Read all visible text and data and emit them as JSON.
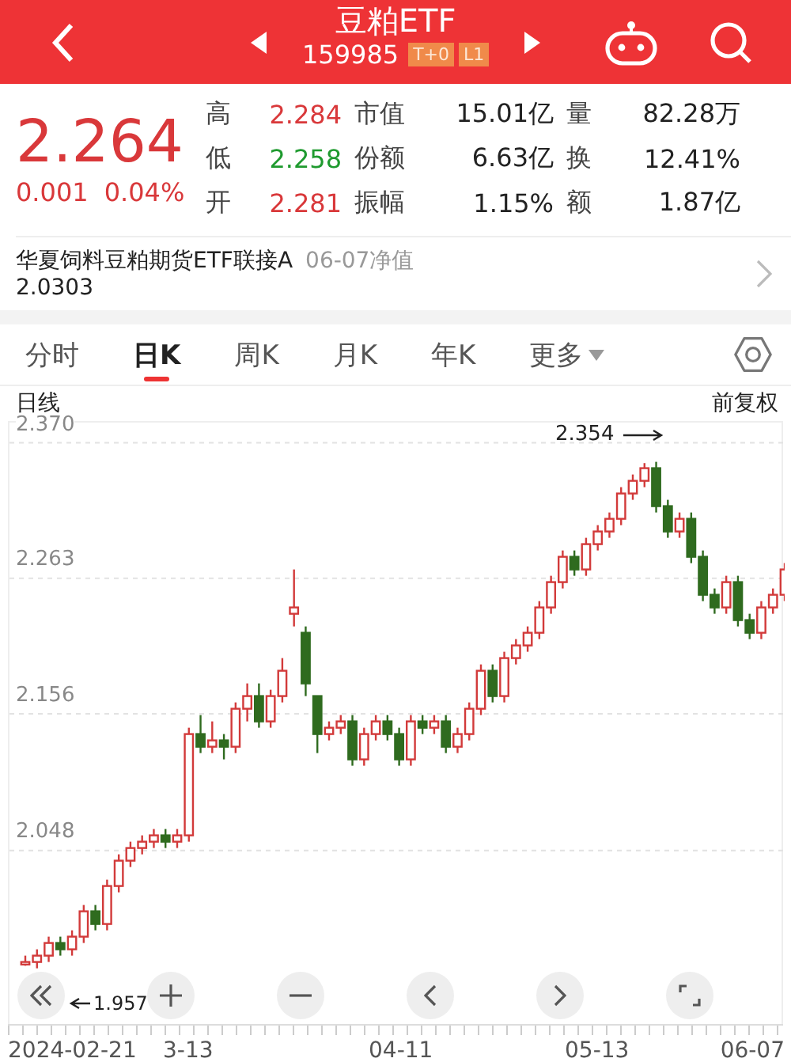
{
  "header": {
    "title": "豆粕ETF",
    "code": "159985",
    "badges": [
      "T+0",
      "L1"
    ]
  },
  "quote": {
    "price": "2.264",
    "change": "0.001",
    "change_pct": "0.04%"
  },
  "prices": [
    {
      "label": "高",
      "value": "2.284",
      "color": "#d9383a"
    },
    {
      "label": "低",
      "value": "2.258",
      "color": "#1f9a2f"
    },
    {
      "label": "开",
      "value": "2.281",
      "color": "#d9383a"
    }
  ],
  "stats": [
    {
      "label": "市值",
      "value": "15.01亿"
    },
    {
      "label": "量",
      "value": "82.28万"
    },
    {
      "label": "份额",
      "value": "6.63亿"
    },
    {
      "label": "换",
      "value": "12.41%"
    },
    {
      "label": "振幅",
      "value": "1.15%"
    },
    {
      "label": "额",
      "value": "1.87亿"
    }
  ],
  "fund": {
    "name": "华夏饲料豆粕期货ETF联接A",
    "date": "06-07净值",
    "value": "2.0303"
  },
  "tabs": [
    {
      "label": "分时",
      "selected": false
    },
    {
      "label": "日K",
      "selected": true
    },
    {
      "label": "周K",
      "selected": false
    },
    {
      "label": "月K",
      "selected": false
    },
    {
      "label": "年K",
      "selected": false
    },
    {
      "label": "更多",
      "selected": false,
      "kind": "menu"
    }
  ],
  "chart": {
    "period": "日线",
    "adjust": "前复权",
    "max_label": "2.354",
    "min_label": "1.957",
    "dates": [
      "2024-02-21",
      "3-13",
      "04-11",
      "05-13",
      "06-07"
    ],
    "chart_data": {
      "type": "candlestick",
      "grid": true,
      "ylim": [
        1.911,
        2.386
      ],
      "yticks": [
        {
          "value": 2.37,
          "label": "2.370"
        },
        {
          "value": 2.263,
          "label": "2.263"
        },
        {
          "value": 2.156,
          "label": "2.156"
        },
        {
          "value": 2.048,
          "label": "2.048"
        }
      ],
      "ohlc": [
        [
          1.958,
          1.965,
          1.957,
          1.96
        ],
        [
          1.96,
          1.97,
          1.955,
          1.965
        ],
        [
          1.965,
          1.98,
          1.96,
          1.975
        ],
        [
          1.975,
          1.98,
          1.965,
          1.97
        ],
        [
          1.97,
          1.985,
          1.965,
          1.98
        ],
        [
          1.98,
          2.005,
          1.975,
          2.0
        ],
        [
          2.0,
          2.005,
          1.985,
          1.99
        ],
        [
          1.99,
          2.025,
          1.985,
          2.02
        ],
        [
          2.02,
          2.045,
          2.015,
          2.04
        ],
        [
          2.04,
          2.055,
          2.035,
          2.05
        ],
        [
          2.05,
          2.06,
          2.045,
          2.055
        ],
        [
          2.055,
          2.065,
          2.05,
          2.06
        ],
        [
          2.06,
          2.065,
          2.05,
          2.055
        ],
        [
          2.055,
          2.065,
          2.05,
          2.06
        ],
        [
          2.06,
          2.145,
          2.055,
          2.14
        ],
        [
          2.14,
          2.155,
          2.125,
          2.13
        ],
        [
          2.13,
          2.15,
          2.125,
          2.135
        ],
        [
          2.135,
          2.14,
          2.12,
          2.13
        ],
        [
          2.13,
          2.165,
          2.125,
          2.16
        ],
        [
          2.16,
          2.18,
          2.15,
          2.17
        ],
        [
          2.17,
          2.18,
          2.145,
          2.15
        ],
        [
          2.15,
          2.175,
          2.145,
          2.17
        ],
        [
          2.17,
          2.2,
          2.165,
          2.19
        ],
        [
          2.235,
          2.27,
          2.225,
          2.24
        ],
        [
          2.22,
          2.225,
          2.17,
          2.18
        ],
        [
          2.17,
          2.17,
          2.125,
          2.14
        ],
        [
          2.14,
          2.15,
          2.135,
          2.145
        ],
        [
          2.145,
          2.155,
          2.14,
          2.15
        ],
        [
          2.15,
          2.155,
          2.115,
          2.12
        ],
        [
          2.12,
          2.145,
          2.115,
          2.14
        ],
        [
          2.14,
          2.155,
          2.135,
          2.15
        ],
        [
          2.15,
          2.155,
          2.135,
          2.14
        ],
        [
          2.14,
          2.145,
          2.115,
          2.12
        ],
        [
          2.12,
          2.155,
          2.115,
          2.15
        ],
        [
          2.15,
          2.155,
          2.14,
          2.145
        ],
        [
          2.145,
          2.155,
          2.14,
          2.15
        ],
        [
          2.15,
          2.155,
          2.125,
          2.13
        ],
        [
          2.13,
          2.145,
          2.125,
          2.14
        ],
        [
          2.14,
          2.165,
          2.135,
          2.16
        ],
        [
          2.16,
          2.195,
          2.155,
          2.19
        ],
        [
          2.19,
          2.195,
          2.165,
          2.17
        ],
        [
          2.17,
          2.205,
          2.165,
          2.2
        ],
        [
          2.2,
          2.215,
          2.195,
          2.21
        ],
        [
          2.21,
          2.225,
          2.205,
          2.22
        ],
        [
          2.22,
          2.245,
          2.215,
          2.24
        ],
        [
          2.24,
          2.265,
          2.235,
          2.26
        ],
        [
          2.26,
          2.285,
          2.255,
          2.28
        ],
        [
          2.28,
          2.285,
          2.265,
          2.27
        ],
        [
          2.27,
          2.295,
          2.265,
          2.29
        ],
        [
          2.29,
          2.305,
          2.285,
          2.3
        ],
        [
          2.3,
          2.315,
          2.295,
          2.31
        ],
        [
          2.31,
          2.335,
          2.305,
          2.33
        ],
        [
          2.33,
          2.345,
          2.325,
          2.34
        ],
        [
          2.34,
          2.354,
          2.335,
          2.35
        ],
        [
          2.35,
          2.355,
          2.315,
          2.32
        ],
        [
          2.32,
          2.325,
          2.295,
          2.3
        ],
        [
          2.3,
          2.315,
          2.295,
          2.31
        ],
        [
          2.31,
          2.315,
          2.275,
          2.28
        ],
        [
          2.28,
          2.285,
          2.245,
          2.25
        ],
        [
          2.25,
          2.255,
          2.235,
          2.24
        ],
        [
          2.24,
          2.265,
          2.235,
          2.26
        ],
        [
          2.26,
          2.265,
          2.225,
          2.23
        ],
        [
          2.23,
          2.235,
          2.215,
          2.22
        ],
        [
          2.22,
          2.245,
          2.215,
          2.24
        ],
        [
          2.24,
          2.255,
          2.235,
          2.25
        ],
        [
          2.25,
          2.275,
          2.245,
          2.27
        ]
      ]
    }
  }
}
